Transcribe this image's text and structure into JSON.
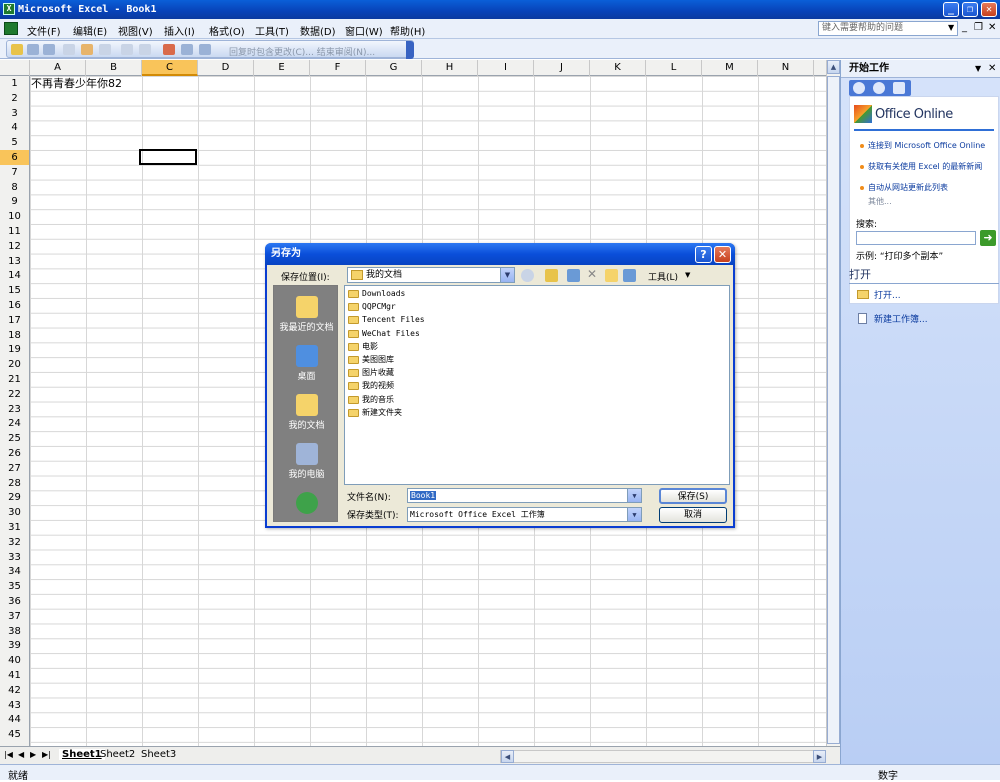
{
  "window": {
    "title": "Microsoft Excel - Book1"
  },
  "menu": [
    "文件(F)",
    "编辑(E)",
    "视图(V)",
    "插入(I)",
    "格式(O)",
    "工具(T)",
    "数据(D)",
    "窗口(W)",
    "帮助(H)"
  ],
  "help_box": {
    "placeholder": "键入需要帮助的问题"
  },
  "toolbar": {
    "review_text": "回复时包含更改(C)...  结束审阅(N)..."
  },
  "columns": [
    "A",
    "B",
    "C",
    "D",
    "E",
    "F",
    "G",
    "H",
    "I",
    "J",
    "K",
    "L",
    "M",
    "N"
  ],
  "rows": [
    "1",
    "2",
    "3",
    "4",
    "5",
    "6",
    "7",
    "8",
    "9",
    "10",
    "11",
    "12",
    "13",
    "14",
    "15",
    "16",
    "17",
    "18",
    "19",
    "20",
    "21",
    "22",
    "23",
    "24",
    "25",
    "26",
    "27",
    "28",
    "29",
    "30",
    "31",
    "32",
    "33",
    "34",
    "35",
    "36",
    "37",
    "38",
    "39",
    "40",
    "41",
    "42",
    "43",
    "44",
    "45"
  ],
  "active_cell": {
    "column": "C",
    "row": "6"
  },
  "cell_a1": "不再青春少年你82",
  "sheets": [
    "Sheet1",
    "Sheet2",
    "Sheet3"
  ],
  "status": {
    "ready": "就绪",
    "mode": "数字"
  },
  "task_pane": {
    "title": "开始工作",
    "office_logo": "Office Online",
    "links": [
      "连接到 Microsoft Office Online",
      "获取有关使用 Excel 的最新新闻",
      "自动从网站更新此列表"
    ],
    "more": "其他...",
    "search_label": "搜索:",
    "example": "示例:  “打印多个副本”",
    "open_header": "打开",
    "open_link": "打开...",
    "new_link": "新建工作簿..."
  },
  "dialog": {
    "title": "另存为",
    "save_in_label": "保存位置(I):",
    "save_in_value": "我的文档",
    "tools_label": "工具(L)",
    "places": [
      "我最近的文档",
      "桌面",
      "我的文档",
      "我的电脑"
    ],
    "files": [
      "Downloads",
      "QQPCMgr",
      "Tencent Files",
      "WeChat Files",
      "电影",
      "美图图库",
      "图片收藏",
      "我的视频",
      "我的音乐",
      "新建文件夹"
    ],
    "filename_label": "文件名(N):",
    "filename_value": "Book1",
    "filetype_label": "保存类型(T):",
    "filetype_value": "Microsoft Office Excel 工作簿",
    "save_button": "保存(S)",
    "cancel_button": "取消"
  },
  "colors": {
    "titlebar": "#0a4fda",
    "active_header": "#f9c45a",
    "taskpane": "#c8d9f8"
  }
}
